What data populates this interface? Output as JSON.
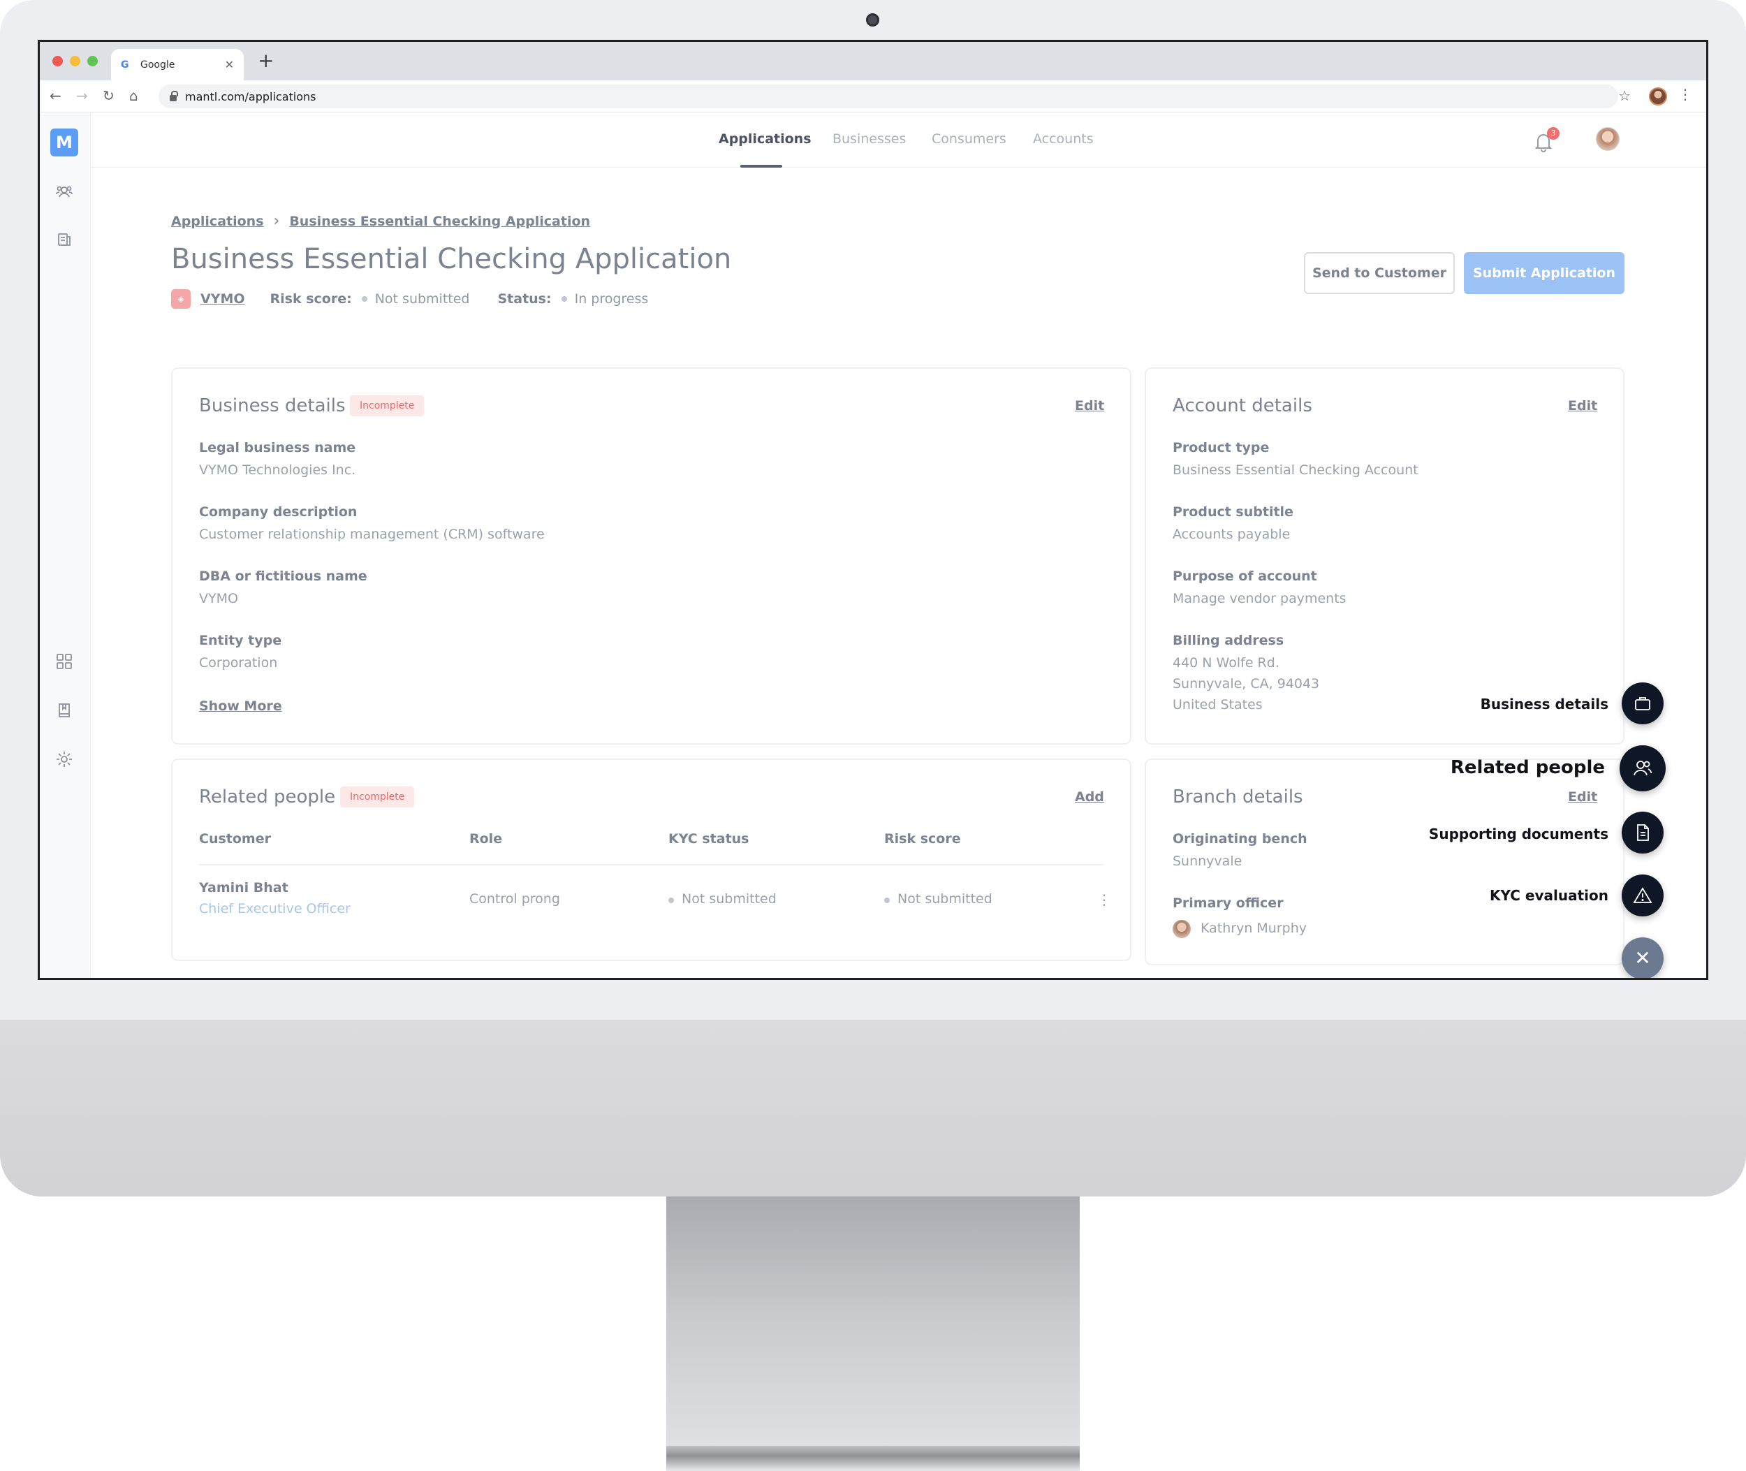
{
  "browser": {
    "tab_title": "Google",
    "tab_favicon": "G",
    "new_tab": "+",
    "url": "mantl.com/applications"
  },
  "app": {
    "logo": "M",
    "nav": {
      "items": [
        "Applications",
        "Businesses",
        "Consumers",
        "Accounts"
      ],
      "active_index": 0
    },
    "notifications_count": "3"
  },
  "page": {
    "breadcrumb": [
      "Applications",
      "Business Essential Checking Application"
    ],
    "title": "Business Essential Checking Application",
    "business_name": "VYMO",
    "risk_label": "Risk score:",
    "risk_value": "Not submitted",
    "status_label": "Status:",
    "status_value": "In progress",
    "send_button": "Send to Customer",
    "submit_button": "Submit Application"
  },
  "business_details": {
    "title": "Business details",
    "badge": "Incomplete",
    "action": "Edit",
    "fields": [
      {
        "label": "Legal business name",
        "value": "VYMO Technologies Inc."
      },
      {
        "label": "Company description",
        "value": "Customer relationship management (CRM) software"
      },
      {
        "label": "DBA or fictitious name",
        "value": "VYMO"
      },
      {
        "label": "Entity type",
        "value": "Corporation"
      }
    ],
    "show_more": "Show More"
  },
  "account_details": {
    "title": "Account details",
    "action": "Edit",
    "fields": [
      {
        "label": "Product type",
        "value": "Business Essential Checking Account"
      },
      {
        "label": "Product subtitle",
        "value": "Accounts payable"
      },
      {
        "label": "Purpose of account",
        "value": "Manage vendor payments"
      },
      {
        "label": "Billing address",
        "lines": [
          "440 N Wolfe Rd.",
          "Sunnyvale, CA, 94043",
          "United States"
        ]
      }
    ]
  },
  "related_people": {
    "title": "Related people",
    "badge": "Incomplete",
    "action": "Add",
    "columns": [
      "Customer",
      "Role",
      "KYC status",
      "Risk score"
    ],
    "rows": [
      {
        "name": "Yamini Bhat",
        "subtitle": "Chief Executive Officer",
        "role": "Control prong",
        "kyc": "Not submitted",
        "risk": "Not submitted"
      }
    ]
  },
  "branch_details": {
    "title": "Branch details",
    "action": "Edit",
    "fields": [
      {
        "label": "Originating bench",
        "value": "Sunnyvale"
      },
      {
        "label": "Primary officer",
        "value": "Kathryn Murphy"
      }
    ]
  },
  "quick_nav": {
    "items": [
      "Business details",
      "Related people",
      "Supporting documents",
      "KYC evaluation"
    ],
    "icons": [
      "briefcase-icon",
      "people-icon",
      "document-icon",
      "warning-icon"
    ],
    "close_icon": "close-icon"
  },
  "colors": {
    "accent": "#5b9cf5",
    "primary_button": "#9bc2f5",
    "badge_bg": "#fde8e8",
    "badge_text": "#e36a6a",
    "fab": "#0f1626"
  }
}
